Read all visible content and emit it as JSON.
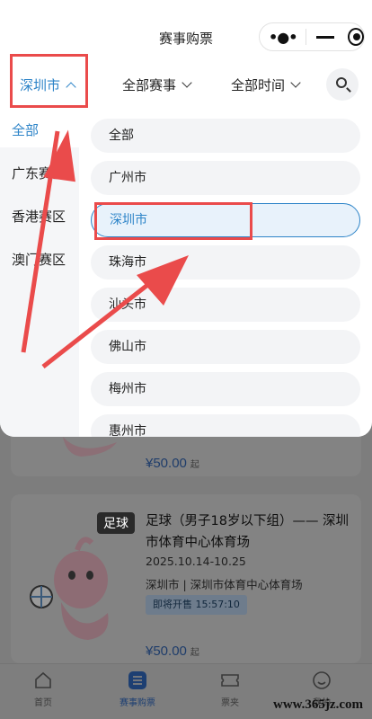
{
  "header": {
    "title": "赛事购票"
  },
  "filters": {
    "city": "深圳市",
    "event": "全部赛事",
    "time": "全部时间"
  },
  "regions": [
    {
      "label": "全部",
      "active": true
    },
    {
      "label": "广东赛区",
      "active": false
    },
    {
      "label": "香港赛区",
      "active": false
    },
    {
      "label": "澳门赛区",
      "active": false
    }
  ],
  "cities": [
    {
      "label": "全部",
      "selected": false
    },
    {
      "label": "广州市",
      "selected": false
    },
    {
      "label": "深圳市",
      "selected": true
    },
    {
      "label": "珠海市",
      "selected": false
    },
    {
      "label": "汕头市",
      "selected": false
    },
    {
      "label": "佛山市",
      "selected": false
    },
    {
      "label": "梅州市",
      "selected": false
    },
    {
      "label": "惠州市",
      "selected": false
    }
  ],
  "cards": [
    {
      "price": "¥50.00",
      "price_suffix": "起"
    },
    {
      "tag": "足球",
      "title": "足球（男子18岁以下组）—— 深圳市体育中心体育场",
      "date": "2025.10.14-10.25",
      "venue": "深圳市 | 深圳市体育中心体育场",
      "status": "即将开售  15:57:10",
      "price": "¥50.00",
      "price_suffix": "起"
    }
  ],
  "tabbar": [
    {
      "label": "首页",
      "icon": "home-icon",
      "active": false
    },
    {
      "label": "赛事购票",
      "icon": "list-icon",
      "active": true
    },
    {
      "label": "票夹",
      "icon": "ticket-icon",
      "active": false
    },
    {
      "label": "我的",
      "icon": "smile-icon",
      "active": false
    }
  ],
  "watermark": "www.365jz.com",
  "colors": {
    "accent": "#2d84c8",
    "annotation": "#ea4b4b"
  }
}
